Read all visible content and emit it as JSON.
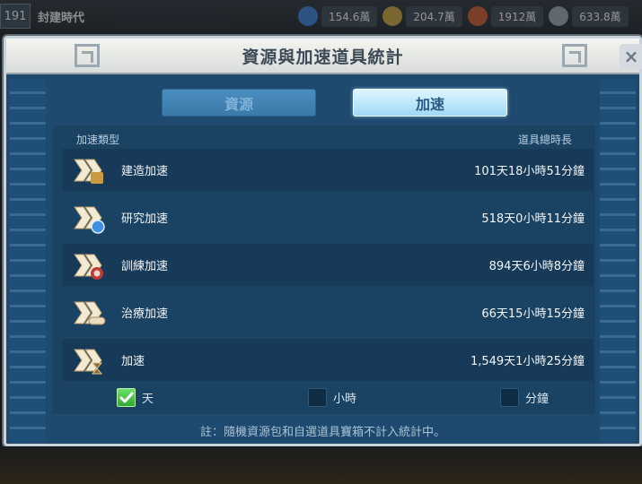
{
  "hud": {
    "level": "191",
    "era": "封建時代",
    "resources": [
      {
        "icon": "food-icon",
        "color": "#3a7fd0",
        "value": "154.6萬"
      },
      {
        "icon": "wood-icon",
        "color": "#c8a23a",
        "value": "204.7萬"
      },
      {
        "icon": "stone-icon",
        "color": "#c85a2a",
        "value": "1912萬"
      },
      {
        "icon": "gold-icon",
        "color": "#9aa4ad",
        "value": "633.8萬"
      }
    ]
  },
  "modal": {
    "title": "資源與加速道具統計",
    "close_label": "×",
    "tabs": [
      {
        "label": "資源",
        "active": false
      },
      {
        "label": "加速",
        "active": true
      }
    ],
    "columns": {
      "type": "加速類型",
      "total": "道具總時長"
    },
    "rows": [
      {
        "name": "建造加速",
        "time": "101天18小時51分鐘",
        "icon": "build-speedup-icon",
        "badge": "#c99a42"
      },
      {
        "name": "研究加速",
        "time": "518天0小時11分鐘",
        "icon": "research-speedup-icon",
        "badge": "#3f8fe0"
      },
      {
        "name": "訓練加速",
        "time": "894天6小時8分鐘",
        "icon": "training-speedup-icon",
        "badge": "#c23a34"
      },
      {
        "name": "治療加速",
        "time": "66天15小時15分鐘",
        "icon": "healing-speedup-icon",
        "badge": "#d9c9a8"
      },
      {
        "name": "加速",
        "time": "1,549天1小時25分鐘",
        "icon": "universal-speedup-icon",
        "badge": "#8a6a3a"
      }
    ],
    "units": [
      {
        "label": "天",
        "checked": true
      },
      {
        "label": "小時",
        "checked": false
      },
      {
        "label": "分鐘",
        "checked": false
      }
    ],
    "footnote": "註：隨機資源包和自選道具寶箱不計入統計中。"
  }
}
